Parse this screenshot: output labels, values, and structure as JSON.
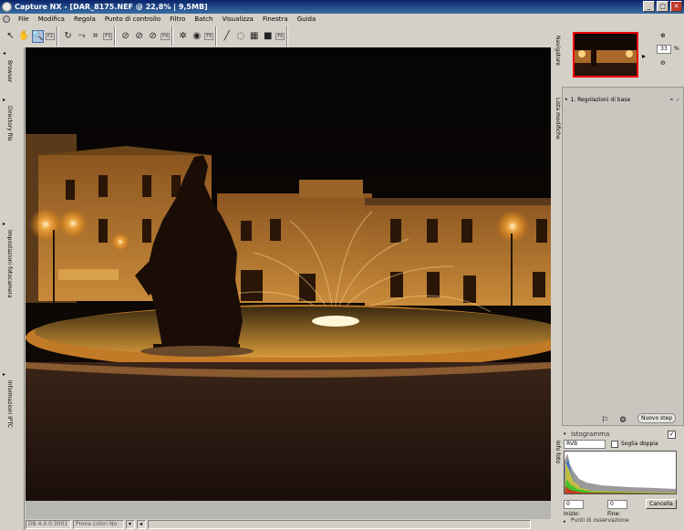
{
  "window": {
    "title": "Capture NX - [DAR_8175.NEF @ 22,8% | 9,5MB]",
    "minimize": "_",
    "maximize": "□",
    "close": "✕"
  },
  "menu": [
    "File",
    "Modifica",
    "Regola",
    "Punto di controllo",
    "Filtro",
    "Batch",
    "Visualizza",
    "Finestra",
    "Guida"
  ],
  "toolbar": {
    "fkeys": {
      "f2": "F2",
      "f3": "F3",
      "f4": "F4",
      "f5": "F5",
      "f6": "F6"
    },
    "icons": [
      "arrow-icon",
      "hand-icon",
      "zoom-icon",
      "rotate-icon",
      "straighten-icon",
      "crop-icon",
      "black-point-icon",
      "white-point-icon",
      "neutral-point-icon",
      "color-control-point-icon",
      "red-eye-icon",
      "selection-brush-icon",
      "lasso-icon",
      "gradient-icon",
      "fill-icon"
    ]
  },
  "left_dock": {
    "tabs": [
      "Browser",
      "Directory file",
      "Impostazioni fotocamera",
      "Informazioni IPTC"
    ]
  },
  "navigator": {
    "tab": "Navigatore",
    "zoom_value": "33",
    "zoom_unit": "%",
    "zoom_in": "⊕",
    "zoom_out": "⊖"
  },
  "edit_list": {
    "tab": "Lista modifiche",
    "items": [
      "1. Regolazioni di base"
    ],
    "new_step": "Nuovo step"
  },
  "histogram": {
    "info_tab": "Info foto",
    "title": "Istogramma",
    "channel": "RVB",
    "threshold_label": "Soglia doppia",
    "start_label": "Inizio:",
    "start_value": "0",
    "end_label": "Fine:",
    "end_value": "0",
    "cancel": "Cancella",
    "watch_points": "Punti di osservazione"
  },
  "status": {
    "version": "DB 4.0.0.3001",
    "color_proof": "Prova colori No"
  },
  "colors": {
    "titlebar": "#0a246a",
    "accent_border": "#ff0000",
    "bg": "#d4d0c8"
  }
}
